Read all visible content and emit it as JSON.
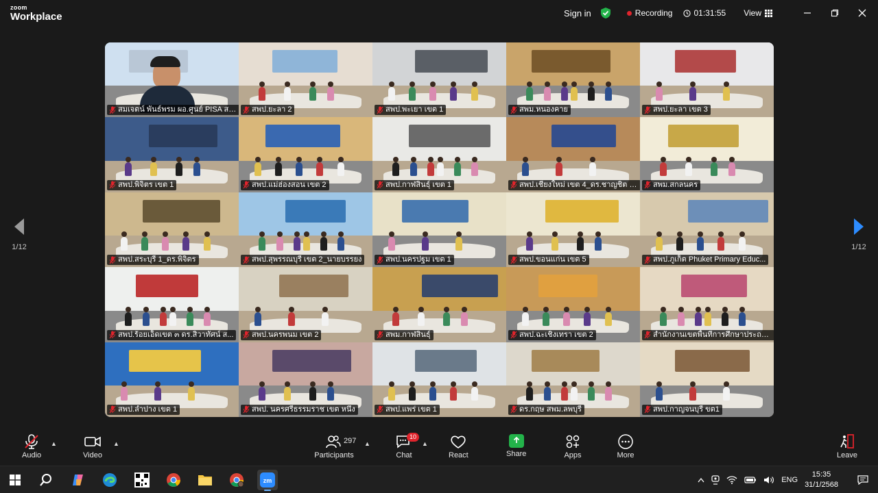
{
  "app": {
    "brand_top": "zoom",
    "brand_bottom": "Workplace"
  },
  "header": {
    "sign_in": "Sign in",
    "recording": "Recording",
    "timer": "01:31:55",
    "view": "View"
  },
  "pagination": {
    "left": "1/12",
    "right": "1/12"
  },
  "tiles": [
    {
      "name": "สมเจตน์ พันธ์พรม ผอ.ศูนย์ PISA สพฐ.",
      "active": true
    },
    {
      "name": "สพป.ยะลา 2"
    },
    {
      "name": "สพป.พะเยา เขต 1"
    },
    {
      "name": "สพม.หนองคาย"
    },
    {
      "name": "สพป.ยะลา เขต 3"
    },
    {
      "name": "สพป.พิจิตร เขต 1"
    },
    {
      "name": "สพป.แม่ฮ่องสอน เขต 2"
    },
    {
      "name": "สพป.กาฬสินธุ์ เขต 1"
    },
    {
      "name": "สพป.เชียงใหม่ เขต 4_ดร.ชาญชิต ทั..."
    },
    {
      "name": "สพม.สกลนคร"
    },
    {
      "name": "สพป.สระบุรี 1_ดร.พิจิตร"
    },
    {
      "name": "สพป.สุพรรณบุรี เขต 2_นายบรรยง"
    },
    {
      "name": "สพป.นครปฐม เขต 1"
    },
    {
      "name": "สพป.ขอนแก่น เขต 5"
    },
    {
      "name": "สพป.ภูเก็ต Phuket Primary Educ..."
    },
    {
      "name": "สพป.ร้อยเอ็ดเขต ๓ ดร.สิวาทัศน์ ส..."
    },
    {
      "name": "สพป.นครพนม เขต 2"
    },
    {
      "name": "สพม.กาฬสินธุ์"
    },
    {
      "name": "สพป.ฉะเชิงเทรา เขต 2"
    },
    {
      "name": "สำนักงานเขตพื้นที่การศึกษาประถม..."
    },
    {
      "name": "สพป.ลำปาง เขต 1"
    },
    {
      "name": "สพป. นครศรีธรรมราช เขต หนึ่ง"
    },
    {
      "name": "สพป.แพร่ เขต 1"
    },
    {
      "name": "ดร.กฤษ สพม.ลพบุรี"
    },
    {
      "name": "สพป.กาญจนบุรี ขต1"
    }
  ],
  "toolbar": {
    "audio": "Audio",
    "video": "Video",
    "participants": "Participants",
    "participants_count": "297",
    "chat": "Chat",
    "chat_badge": "10",
    "react": "React",
    "share": "Share",
    "apps": "Apps",
    "more": "More",
    "leave": "Leave"
  },
  "taskbar": {
    "lang": "ENG",
    "time": "15:35",
    "date": "31/1/2568"
  },
  "colors": {
    "accent_green": "#3bd16f",
    "record_red": "#e0242c",
    "share_green": "#23b34a"
  }
}
